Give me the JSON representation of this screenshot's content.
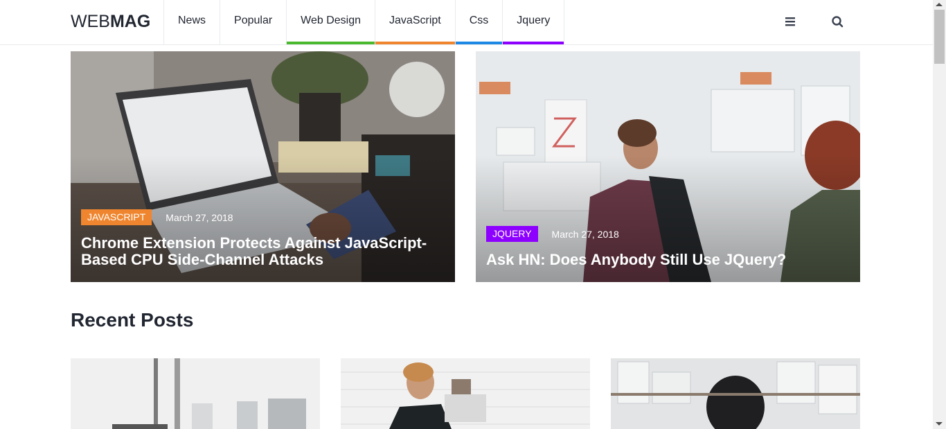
{
  "header": {
    "logo_thin": "WEB",
    "logo_bold": "MAG",
    "nav": [
      {
        "label": "News",
        "accent": ""
      },
      {
        "label": "Popular",
        "accent": ""
      },
      {
        "label": "Web Design",
        "accent": "#4bb92f"
      },
      {
        "label": "JavaScript",
        "accent": "#ef862f"
      },
      {
        "label": "Css",
        "accent": "#1e88e5"
      },
      {
        "label": "Jquery",
        "accent": "#8d00ff"
      }
    ],
    "icons": [
      "menu-icon",
      "search-icon"
    ]
  },
  "featured": [
    {
      "category": "JAVASCRIPT",
      "category_color": "#ef862f",
      "date": "March 27, 2018",
      "title": "Chrome Extension Protects Against JavaScript-Based CPU Side-Channel Attacks"
    },
    {
      "category": "JQUERY",
      "category_color": "#8d00ff",
      "date": "March 27, 2018",
      "title": "Ask HN: Does Anybody Still Use JQuery?"
    }
  ],
  "recent": {
    "title": "Recent Posts"
  }
}
